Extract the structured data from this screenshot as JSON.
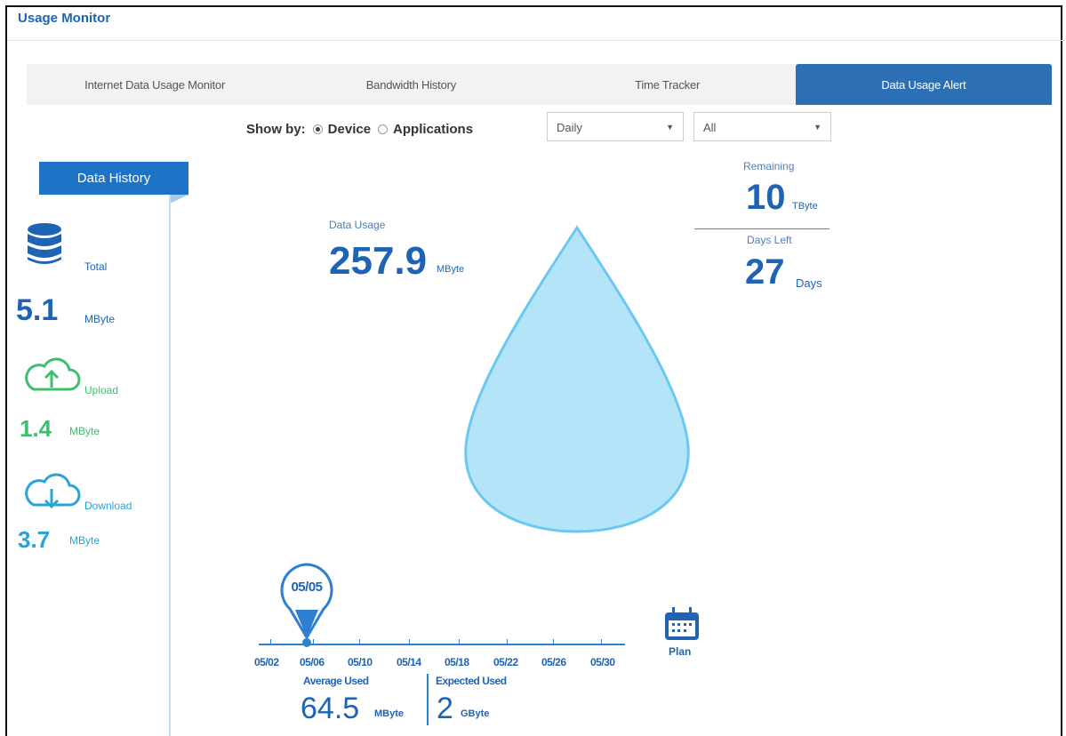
{
  "header": {
    "title": "Usage Monitor"
  },
  "tabs": [
    {
      "label": "Internet Data Usage Monitor",
      "active": false
    },
    {
      "label": "Bandwidth History",
      "active": false
    },
    {
      "label": "Time Tracker",
      "active": false
    },
    {
      "label": "Data Usage Alert",
      "active": true
    }
  ],
  "filters": {
    "show_by_label": "Show by:",
    "options": [
      {
        "label": "Device",
        "checked": true
      },
      {
        "label": "Applications",
        "checked": false
      }
    ],
    "period_select": "Daily",
    "scope_select": "All"
  },
  "sidebar": {
    "tab_label": "Data History",
    "total": {
      "label": "Total",
      "value": "5.1",
      "unit": "MByte",
      "icon": "database-icon",
      "color": "#1f63b5"
    },
    "upload": {
      "label": "Upload",
      "value": "1.4",
      "unit": "MByte",
      "icon": "cloud-upload-icon",
      "color": "#3dbf6e"
    },
    "download": {
      "label": "Download",
      "value": "3.7",
      "unit": "MByte",
      "icon": "cloud-download-icon",
      "color": "#2aa3d6"
    }
  },
  "usage": {
    "label": "Data Usage",
    "value": "257.9",
    "unit": "MByte",
    "drop_color": "#b3e4f8",
    "drop_stroke": "#6cc8f0"
  },
  "remaining": {
    "label": "Remaining",
    "value": "10",
    "unit": "TByte",
    "days_label": "Days Left",
    "days_value": "27",
    "days_unit": "Days"
  },
  "timeline": {
    "marker_label": "05/05",
    "dates": [
      "05/02",
      "05/06",
      "05/10",
      "05/14",
      "05/18",
      "05/22",
      "05/26",
      "05/30"
    ],
    "average_label": "Average Used",
    "average_value": "64.5",
    "average_unit": "MByte",
    "expected_label": "Expected Used",
    "expected_value": "2",
    "expected_unit": "GByte",
    "plan_label": "Plan"
  }
}
